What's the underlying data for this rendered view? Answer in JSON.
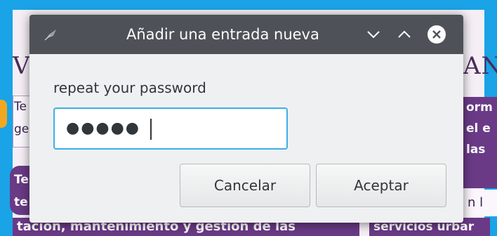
{
  "window": {
    "title": "Añadir una entrada nueva"
  },
  "dialog": {
    "prompt": "repeat your password",
    "password_value": "●●●●●",
    "cancel_label": "Cancelar",
    "ok_label": "Aceptar"
  },
  "background": {
    "title_left": "VL",
    "title_right": "AN",
    "left_box_line1": "Te",
    "left_box_line2": "ge",
    "left_strip_line1": "Te",
    "left_strip_line2": "te",
    "right_box_line1": "orm",
    "right_box_line2": "el e",
    "right_box_line3": "las",
    "right_lower": "n l",
    "bottom_left": "tacion, mantenimiento y gestion de las",
    "bottom_right": "servicios urbar"
  },
  "colors": {
    "desktop": "#1aa3e6",
    "titlebar": "#4e5258",
    "focus": "#3daee9",
    "background_accent": "#6a3a86"
  },
  "icons": {
    "app": "quill-icon",
    "minimize": "chevron-down-icon",
    "maximize": "chevron-up-icon",
    "close": "close-icon"
  }
}
